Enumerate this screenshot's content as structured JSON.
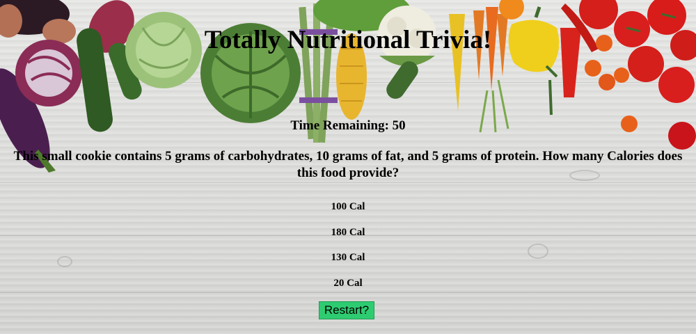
{
  "quiz": {
    "title": "Totally Nutritional Trivia!",
    "timer": {
      "label": "Time Remaining:",
      "value": 50,
      "text": "Time Remaining: 50"
    },
    "question": "This small cookie contains 5 grams of carbohydrates, 10 grams of fat, and 5 grams of protein. How many Calories does this food provide?",
    "answers": [
      {
        "label": "100 Cal"
      },
      {
        "label": "180 Cal"
      },
      {
        "label": "130 Cal"
      },
      {
        "label": "20 Cal"
      }
    ],
    "restart_label": "Restart?"
  },
  "colors": {
    "restart_button": "#2ecc71",
    "background": "#dcdcdc"
  },
  "decoration": {
    "background": "wood-planks",
    "vegetables": [
      "eggplant",
      "red-onion",
      "radicchio",
      "zucchini",
      "cabbage",
      "savoy-cabbage",
      "asparagus",
      "corn",
      "cauliflower",
      "cucumber",
      "yellow-pepper",
      "carrots",
      "red-chili-pepper",
      "cherry-tomatoes",
      "tomatoes"
    ]
  }
}
